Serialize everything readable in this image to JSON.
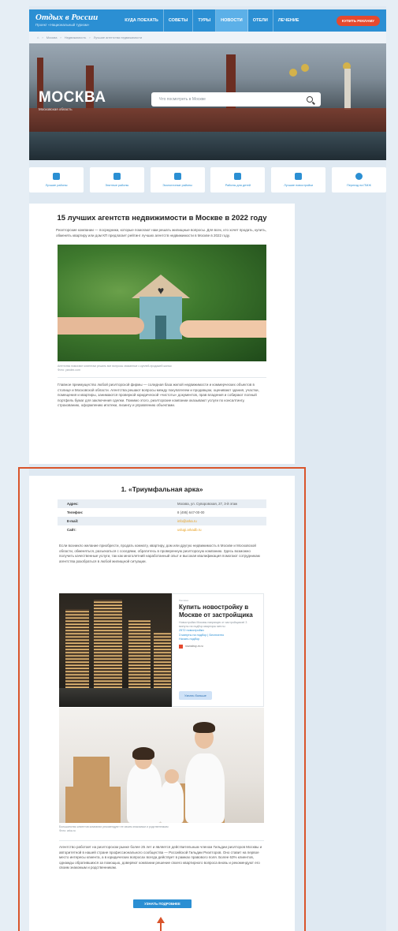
{
  "header": {
    "logo_title": "Отдых в России",
    "logo_sub": "Проект «Национальный туризм»",
    "nav": [
      "КУДА ПОЕХАТЬ",
      "СОВЕТЫ",
      "ТУРЫ",
      "НОВОСТИ",
      "ОТЕЛИ",
      "ЛЕЧЕНИЕ"
    ],
    "active_nav": "НОВОСТИ",
    "cta": "КУПИТЬ РЕКЛАМУ"
  },
  "breadcrumbs": [
    "Москва",
    "Недвижимость",
    "Лучшие агентства недвижимости"
  ],
  "hero": {
    "city": "МОСКВА",
    "region": "Московская область",
    "search_placeholder": "Что посмотреть в Москве"
  },
  "categories": [
    "Лучшие районы",
    "Элитные районы",
    "Экологичные районы",
    "Районы для детей",
    "Лучшие новостройки",
    "Переезд на ПМЖ"
  ],
  "article": {
    "title": "15 лучших агентств недвижимости в Москве в 2022 году",
    "intro": "Риэлторские компании — посредники, которые помогают нам решать жилищные вопросы. Для всех, кто хочет продать, купить, обменять квартиру или дом КП предлагает рейтинг лучших агентств недвижимости в Москве в 2022 году.",
    "photo_caption": "Агентства помогают клиентам решать все вопросы связанные с куплей-продажей жилья",
    "photo_credit": "Фото: yandex.com",
    "body": "Главное преимущество любой риэлторской фирмы — солидная база жилой недвижимости и коммерческих объектов в столице и Московской области. Агентства решают вопросы между покупателем и продавцом, оценивают здания, участки, помещения и квартиры, занимаются проверкой юридической «чистоты» документов, прав владения и собирают полный портфель бумаг для заключения сделки. Помимо этого, риэлторские компании оказывают услуги по консалтингу, страхованию, оформлению ипотеки, лизингу и управлению объектами."
  },
  "section": {
    "title": "1. «Триумфальная арка»",
    "info": [
      {
        "key": "Адрес:",
        "value": "Москва, ул. Суворовская, 27, 3-й этаж"
      },
      {
        "key": "Телефон:",
        "value": "8 (495) 647-00-00"
      },
      {
        "key": "E-mail:",
        "value": "info@arka.ru"
      },
      {
        "key": "Сайт:",
        "value": "uslugi.arkadb.ru"
      }
    ],
    "paragraph1": "Если возникло желание приобрести, продать комнату, квартиру, дом или другую недвижимость в Москве и Московской области, обменяться, разъехаться с соседями, обратитесь в проверенную риэлторскую компанию. Здесь возможно получить качественные услуги, так как многолетний наработанный опыт и высокая квалификация помогают сотрудникам агентства разобраться в любой жилищной ситуации.",
    "ad": {
      "tag": "Реклама",
      "title": "Купить новостройку в Москве от застройщика",
      "text": "Новостройки Москвы напрямую от застройщиков! 3 минуты на подбор квартиры мечты",
      "link1": "2572 новостройки",
      "link2": "3 минуты на подбор  |  Бесплатно",
      "link3": "Начать подбор",
      "domain": "novostroy-m.ru",
      "button": "Узнать больше"
    },
    "photo_caption": "Большинство клиентов компании рекомендуют ее своим знакомым и родственникам",
    "photo_credit": "Фото: arka.ru",
    "paragraph2": "Агентство работает на риэлторском рынке более 25 лет и является действительным членом Гильдии риэлторов Москвы и авторитетной в нашей стране профессионального сообщества — Российской Гильдии Риэлторов. Оно ставит на первое место интересы клиента, а в юридических вопросах всегда действует в рамках правового поля. Более 63% клиентов, однажды обратившихся за помощью, доверяют компании решение своего квартирного вопроса вновь и рекомендуют его своим знакомым и родственникам.",
    "button": "УЗНАТЬ ПОДРОБНЕЕ"
  },
  "colors": {
    "accent": "#2b8fd3",
    "highlight": "#d9542b",
    "cta": "#e5492e",
    "link": "#e8a020"
  }
}
